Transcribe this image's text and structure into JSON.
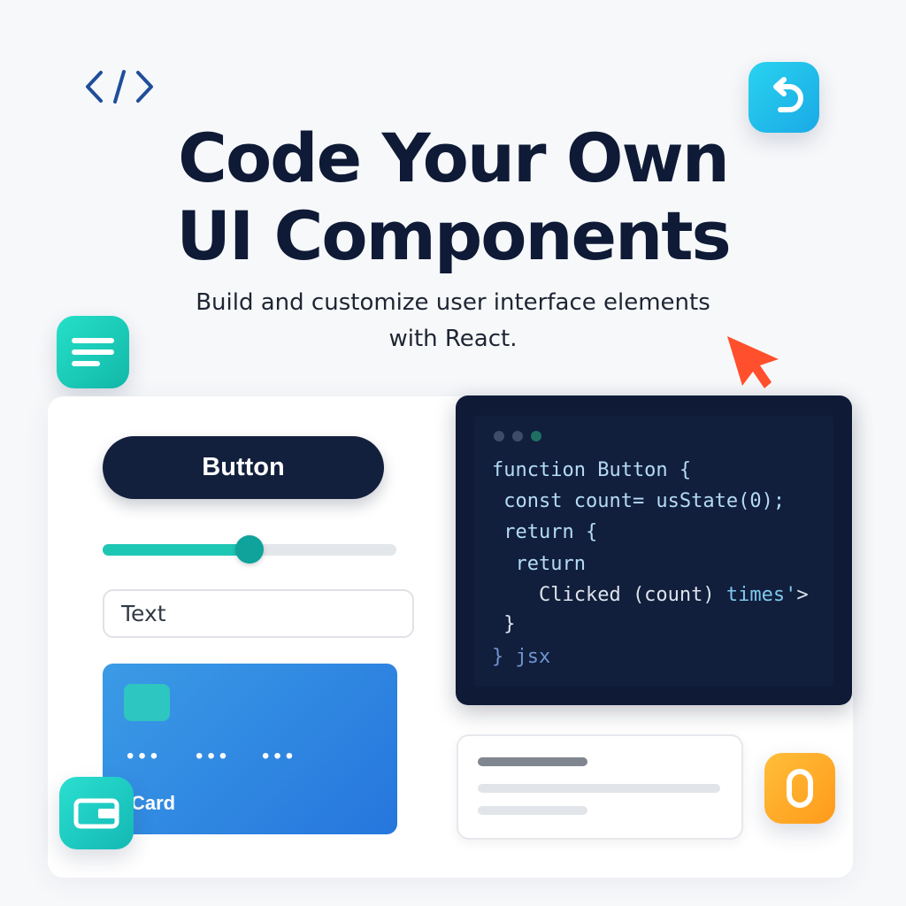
{
  "header": {
    "title_line_1": "Code Your Own",
    "title_line_2": "UI Components",
    "subtitle_line_1": "Build and customize user interface elements",
    "subtitle_line_2": "with React."
  },
  "icons": {
    "top_left": "code-brackets-icon",
    "undo": "undo-icon",
    "document": "text-lines-icon",
    "wallet": "wallet-icon",
    "zero": "zero-icon",
    "cursor": "cursor-icon"
  },
  "components": {
    "button_label": "Button",
    "slider_value": 0.5,
    "text_input_value": "Text",
    "card": {
      "dots": [
        "•••",
        "•••",
        "•••"
      ],
      "label": "Card"
    }
  },
  "code_editor": {
    "lines": [
      "function Button {",
      " const count= usState(0);",
      " return {",
      "  return",
      "    Clicked (count) times'>",
      " }",
      "} jsx"
    ],
    "window_dot_colors": [
      "#3e4c6a",
      "#3e4c6a",
      "#1f6f62"
    ]
  },
  "colors": {
    "title": "#0e1a36",
    "button": "#13203d",
    "slider_fill": "#1ec6b4",
    "card": "#2a84e0",
    "cursor": "#ff4f2c",
    "editor_bg": "#0f1a36"
  }
}
